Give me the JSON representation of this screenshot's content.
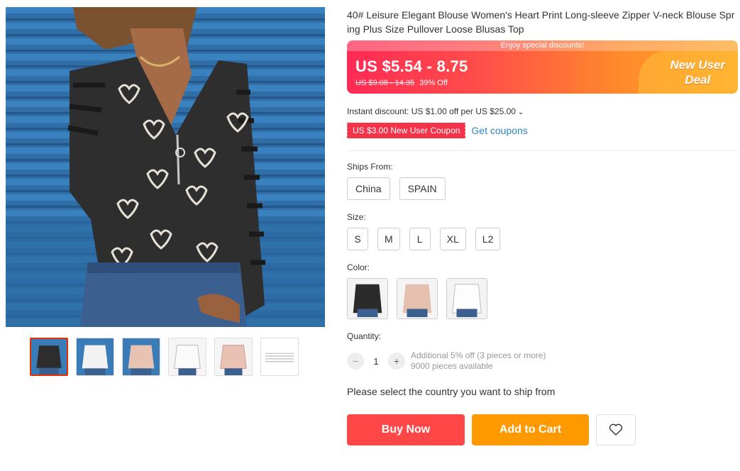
{
  "product": {
    "title": "40# Leisure Elegant Blouse Women's Heart Print Long-sleeve Zipper V-neck Blouse Spring Plus Size Pullover Loose Blusas Top"
  },
  "gallery": {
    "main_image": "woman-in-heart-print-zipper-blouse",
    "thumbnails": [
      {
        "name": "black-blouse-thumb",
        "active": true
      },
      {
        "name": "white-blouse-thumb",
        "active": false
      },
      {
        "name": "pink-blouse-thumb",
        "active": false
      },
      {
        "name": "white-stripe-blouse-thumb",
        "active": false
      },
      {
        "name": "pink-stripe-blouse-thumb",
        "active": false
      },
      {
        "name": "size-chart-thumb",
        "active": false
      }
    ]
  },
  "price": {
    "promo_strip": "Enjoy special discounts!",
    "current": "US $5.54 - 8.75",
    "original": "US $9.08 - 14.35",
    "discount": "39% Off",
    "deal_line1": "New User",
    "deal_line2": "Deal",
    "banner_colors": {
      "start": "#ff2a55",
      "end": "#ffa52a"
    }
  },
  "discounts": {
    "instant": "Instant discount: US $1.00 off per US $25.00",
    "coupon": "US $3.00 New User Coupon",
    "get_coupons": "Get coupons"
  },
  "options": {
    "ships_from_label": "Ships From:",
    "ships_from": [
      "China",
      "SPAIN"
    ],
    "size_label": "Size:",
    "sizes": [
      "S",
      "M",
      "L",
      "XL",
      "L2"
    ],
    "color_label": "Color:",
    "colors": [
      "black-heart-blouse",
      "pink-heart-blouse",
      "white-heart-blouse"
    ]
  },
  "quantity": {
    "label": "Quantity:",
    "value": "1",
    "minus": "−",
    "plus": "+",
    "info_line1": "Additional 5% off (3 pieces or more)",
    "info_line2": "9000 pieces available"
  },
  "ship_note": "Please select the country you want to ship from",
  "actions": {
    "buy_now": "Buy Now",
    "add_to_cart": "Add to Cart",
    "wishlist_icon": "heart-icon",
    "buy_color": "#ff4747",
    "cart_color": "#ff9900"
  }
}
